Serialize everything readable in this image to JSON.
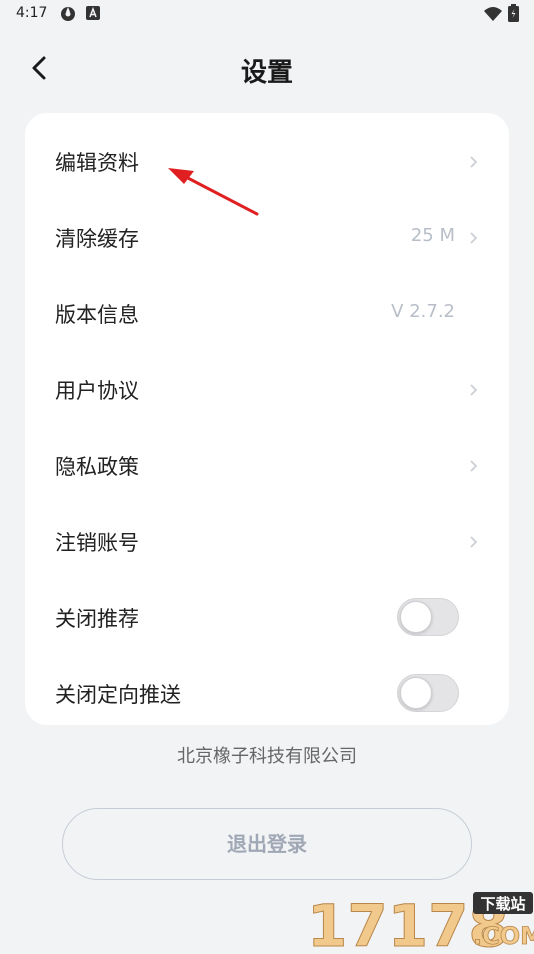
{
  "status_bar": {
    "time": "4:17"
  },
  "header": {
    "title": "设置"
  },
  "settings": [
    {
      "label": "编辑资料",
      "value": "",
      "type": "chevron"
    },
    {
      "label": "清除缓存",
      "value": "25 M",
      "type": "chevron"
    },
    {
      "label": "版本信息",
      "value": "V 2.7.2",
      "type": "none"
    },
    {
      "label": "用户协议",
      "value": "",
      "type": "chevron"
    },
    {
      "label": "隐私政策",
      "value": "",
      "type": "chevron"
    },
    {
      "label": "注销账号",
      "value": "",
      "type": "chevron"
    },
    {
      "label": "关闭推荐",
      "value": "",
      "type": "toggle",
      "on": false
    },
    {
      "label": "关闭定向推送",
      "value": "",
      "type": "toggle",
      "on": false
    }
  ],
  "footer": {
    "company": "北京橡子科技有限公司"
  },
  "logout": {
    "label": "退出登录"
  },
  "watermark": {
    "number": "17178",
    "tag": "下载站",
    "domain": ".COM"
  },
  "colors": {
    "card_bg": "#ffffff",
    "page_bg": "#f2f3f5",
    "muted": "#b8bec8",
    "arrow": "#e02020"
  }
}
